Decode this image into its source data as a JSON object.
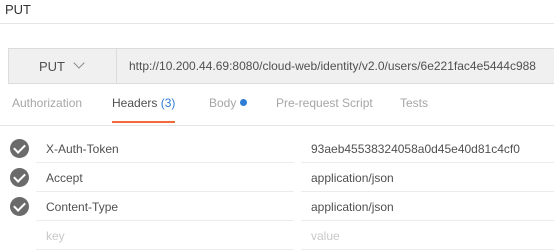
{
  "request": {
    "title": "PUT",
    "method": "PUT",
    "url": "http://10.200.44.69:8080/cloud-web/identity/v2.0/users/6e221fac4e5444c988"
  },
  "tabs": [
    {
      "label": "Authorization",
      "active": false
    },
    {
      "label": "Headers",
      "count": "(3)",
      "active": true
    },
    {
      "label": "Body",
      "active": false
    },
    {
      "label": "Pre-request Script",
      "active": false
    },
    {
      "label": "Tests",
      "active": false
    }
  ],
  "headers": [
    {
      "key": "X-Auth-Token",
      "value": "93aeb45538324058a0d45e40d81c4cf0",
      "enabled": true
    },
    {
      "key": "Accept",
      "value": "application/json",
      "enabled": true
    },
    {
      "key": "Content-Type",
      "value": "application/json",
      "enabled": true
    }
  ],
  "new_row": {
    "key_placeholder": "key",
    "value_placeholder": "value"
  },
  "colors": {
    "accent_underline": "#f26b3a",
    "link_blue": "#2e7cd6",
    "check_fill": "#6b6b6b"
  }
}
